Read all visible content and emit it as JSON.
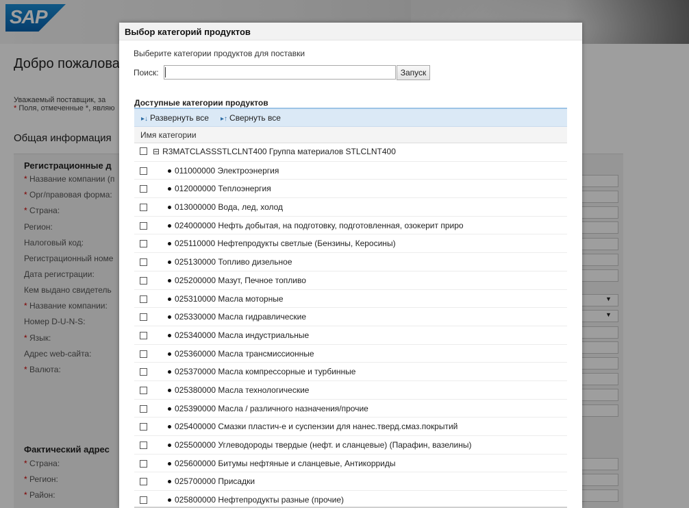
{
  "brand": {
    "logo_text": "SAP"
  },
  "background_page": {
    "title": "Добро пожалова",
    "intro_line1": "Уважаемый поставщик, за",
    "intro_line2_mark": "*",
    "intro_line2": " Поля, отмеченные *, являю",
    "section_general": "Общая информация",
    "subsection_registration": "Регистрационные д",
    "fields": [
      {
        "label": "Название компании (п",
        "required": "*"
      },
      {
        "label": "Орг/правовая форма:",
        "required": "*"
      },
      {
        "label": "Страна:",
        "required": "*"
      },
      {
        "label": "Регион:",
        "required": ""
      },
      {
        "label": "Налоговый код:",
        "required": ""
      },
      {
        "label": "Регистрационный номе",
        "required": ""
      },
      {
        "label": "Дата регистрации:",
        "required": ""
      },
      {
        "label": "Кем выдано свидетель",
        "required": ""
      },
      {
        "label": "Название компании:",
        "required": "*"
      },
      {
        "label": "Номер D-U-N-S:",
        "required": ""
      },
      {
        "label": "Язык:",
        "required": "*"
      },
      {
        "label": "Адрес web-сайта:",
        "required": ""
      },
      {
        "label": "Валюта:",
        "required": "*"
      }
    ],
    "subsection_address": "Фактический адрес",
    "address_fields": [
      {
        "label": "Страна:",
        "required": "*"
      },
      {
        "label": "Регион:",
        "required": "*"
      },
      {
        "label": "Район:",
        "required": "*"
      }
    ],
    "select_arrow_glyph": "▼"
  },
  "dialog": {
    "title": "Выбор категорий продуктов",
    "subtitle": "Выберите категории продуктов для поставки",
    "search": {
      "label": "Поиск:",
      "value": "",
      "placeholder": ""
    },
    "run_button": "Запуск",
    "list_heading": "Доступные категории продуктов",
    "toolbar": {
      "expand_icon": "▸↓",
      "expand_all": "Развернуть все",
      "collapse_icon": "▸↑",
      "collapse_all": "Свернуть все"
    },
    "column_header": "Имя категории",
    "tree_root": {
      "toggle": "⊟",
      "label": "R3MATCLASSSTLCLNT400 Группа материалов STLCLNT400"
    },
    "categories": [
      "011000000 Электроэнергия",
      "012000000 Теплоэнергия",
      "013000000 Вода, лед, холод",
      "024000000 Нефть добытая, на подготовку, подготовленная, озокерит приро",
      "025110000 Нефтепродукты светлые (Бензины, Керосины)",
      "025130000 Топливо дизельное",
      "025200000 Мазут, Печное топливо",
      "025310000 Масла моторные",
      "025330000 Масла гидравлические",
      "025340000 Масла индустриальные",
      "025360000 Масла трансмиссионные",
      "025370000 Масла компрессорные и турбинные",
      "025380000 Масла технологические",
      "025390000 Масла / различного назначения/прочие",
      "025400000 Смазки пластич-е и суспензии для нанес.тверд.смаз.покрытий",
      "025500000 Углеводороды твердые (нефт. и сланцевые) (Парафин, вазелины)",
      "025600000 Битумы нефтяные и сланцевые, Антикорриды",
      "025700000 Присадки",
      "025800000 Нефтепродукты разные (прочие)"
    ]
  }
}
